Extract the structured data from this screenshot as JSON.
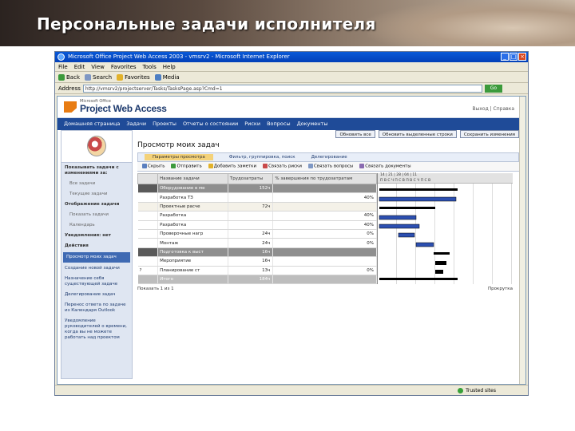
{
  "slide": {
    "title": "Персональные задачи исполнителя"
  },
  "browser": {
    "title": "Microsoft Office Project Web Access 2003 - vmsrv2 - Microsoft Internet Explorer",
    "menu": [
      "File",
      "Edit",
      "View",
      "Favorites",
      "Tools",
      "Help"
    ],
    "toolbar": [
      "Back",
      "Search",
      "Favorites",
      "Media"
    ],
    "address_label": "Address",
    "address": "http://vmsrv2/projectserver/Tasks/TasksPage.asp?Cmd=1",
    "go_label": "Go",
    "status_right": "Trusted sites"
  },
  "pwa": {
    "logo_small": "Microsoft Office",
    "logo_text": "Project Web Access",
    "top_links": "Выход | Справка",
    "nav": [
      "Домашняя страница",
      "Задачи",
      "Проекты",
      "Отчеты о состоянии",
      "Риски",
      "Вопросы",
      "Документы"
    ],
    "left_pane": {
      "items": [
        {
          "text": "Показывать задачи с изменениями за:",
          "kind": "head"
        },
        {
          "text": "Все задачи",
          "kind": "sub"
        },
        {
          "text": "Текущие задачи",
          "kind": "sub"
        },
        {
          "text": "Отображение задачи",
          "kind": "head"
        },
        {
          "text": "Показать задачи",
          "kind": "sub"
        },
        {
          "text": "Календарь",
          "kind": "sub"
        },
        {
          "text": "Уведомления: нет",
          "kind": "head"
        },
        {
          "text": "Действия",
          "kind": "head"
        },
        {
          "text": "Просмотр моих задач",
          "kind": "active"
        },
        {
          "text": "Создание новой задачи",
          "kind": "link"
        },
        {
          "text": "Назначение себя существующей задаче",
          "kind": "link"
        },
        {
          "text": "Делегирование задач",
          "kind": "link"
        },
        {
          "text": "Перенос ответа по задаче из Календаря Outlook",
          "kind": "link"
        },
        {
          "text": "Уведомление руководителей о времени, когда вы не можете работать над проектом",
          "kind": "link"
        }
      ]
    },
    "actions": [
      "Обновить все",
      "Обновить выделенные строки",
      "Сохранить изменения"
    ],
    "page_title": "Просмотр моих задач",
    "view_tabs": [
      "Параметры просмотра",
      "Фильтр, группировка, поиск",
      "Делегирование"
    ],
    "task_toolbar": [
      "Скрыть",
      "Отправить",
      "Добавить заметки",
      "Связать риски",
      "Связать вопросы",
      "Связать документы"
    ],
    "grid": {
      "headers": [
        "",
        "Название задачи",
        "Трудозатраты",
        "% завершения по трудозатратам"
      ],
      "rows": [
        {
          "ind": "",
          "name": "Оборудование в ме",
          "work": "152ч",
          "pct": "",
          "type": "summary"
        },
        {
          "ind": "",
          "name": "Разработка ТЗ",
          "work": "",
          "pct": "40%",
          "type": "task",
          "red": true
        },
        {
          "ind": "",
          "name": "Проектные расче",
          "work": "72ч",
          "pct": "",
          "type": "sub-summary"
        },
        {
          "ind": "",
          "name": "Разработка",
          "work": "",
          "pct": "40%",
          "type": "task",
          "red": true
        },
        {
          "ind": "",
          "name": "Разработка",
          "work": "",
          "pct": "40%",
          "type": "task",
          "red": true
        },
        {
          "ind": "",
          "name": "Проверочные нагр",
          "work": "24ч",
          "pct": "0%",
          "type": "task"
        },
        {
          "ind": "",
          "name": "Монтаж",
          "work": "24ч",
          "pct": "0%",
          "type": "task"
        },
        {
          "ind": "",
          "name": "Подготовка к выст",
          "work": "16ч",
          "pct": "",
          "type": "summary"
        },
        {
          "ind": "",
          "name": "Мероприятие",
          "work": "16ч",
          "pct": "",
          "type": "task"
        },
        {
          "ind": "?",
          "name": "Планирование ст",
          "work": "13ч",
          "pct": "0%",
          "type": "task"
        },
        {
          "ind": "",
          "name": "Итого",
          "work": "184ч",
          "pct": "",
          "type": "total"
        }
      ]
    },
    "gantt": {
      "header_top": "14 | 21 | 28 | 04 | 11",
      "header_bottom": "П В С Ч П С В П В С Ч П С В"
    },
    "bottom_note": "Показать 1 из 1",
    "scroll_label": "Прокрутка"
  }
}
